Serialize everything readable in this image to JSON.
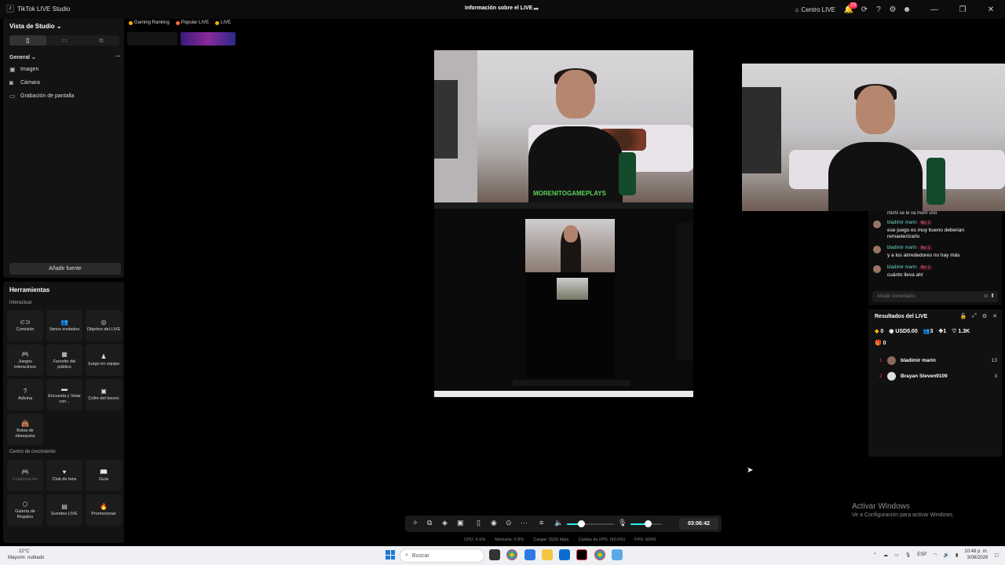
{
  "titlebar": {
    "app_title": "TikTok LIVE Studio",
    "center_title": "Información sobre el LIVE",
    "live_center": "Centro LIVE",
    "notif_count": "23"
  },
  "left_panel": {
    "studio_view": "Vista de Studio",
    "general": "General",
    "sources": [
      "Imagen",
      "Cámara",
      "Grabación de pantalla"
    ],
    "add_source": "Añadir fuente"
  },
  "tools": {
    "title": "Herramientas",
    "interact_label": "Interactuar",
    "growth_label": "Centro de crecimiento",
    "interact_items": [
      "Comisión",
      "Varios invitados",
      "Objetivo del LIVE",
      "Juegos interactivos",
      "Favorito del público",
      "Juego en equipo",
      "Adivina",
      "Encuesta y Votar con...",
      "Cofre del tesoro",
      "Bolsa de obsequios"
    ],
    "growth_items": [
      "Colaboración",
      "Club de fans",
      "Guía",
      "Galería de Regalos",
      "Eventos LIVE",
      "Promocionar"
    ]
  },
  "top_tabs": [
    "Gaming Ranking",
    "Popular LIVE",
    "LIVE"
  ],
  "preview": {
    "shirt_text": "MORENITOGAMEPLAYS"
  },
  "chat": {
    "top_text": "michi se le va morir uno",
    "messages": [
      {
        "user": "bladimir marin",
        "badge": "No. 1",
        "text": "ese juego es muy bueno deberian remasterizarlo"
      },
      {
        "user": "bladimir marin",
        "badge": "No. 1",
        "text": "y a los alrrededores no hay más"
      },
      {
        "user": "bladimir marin",
        "badge": "No. 1",
        "text": "cuánto lleva ahí"
      }
    ],
    "comment_placeholder": "Añadir comentario"
  },
  "results": {
    "title": "Resultados del LIVE",
    "coins": "0",
    "usd": "USD0.00",
    "viewers": "3",
    "new_followers": "1",
    "likes": "1.3K",
    "gifts": "0",
    "ranking": [
      {
        "rank": "1",
        "name": "bladimir marin",
        "count": "13"
      },
      {
        "rank": "2",
        "name": "Brayan Steven9109",
        "count": "3"
      }
    ]
  },
  "activate_windows": {
    "title": "Activar Windows",
    "sub": "Ve a Configuración para activar Windows."
  },
  "controls": {
    "timer": "03:06:42",
    "speaker_level": 0.3,
    "mic_level": 0.55
  },
  "stats": {
    "cpu": "CPU: 4.5%",
    "memory": "Memoria: 0.8%",
    "upload": "Cargar: 5526 kbps",
    "dropped": "Caídas de FPS: 0(0.0%)",
    "fps": "FPS: 60/60"
  },
  "taskbar": {
    "weather_temp": "22°C",
    "weather_desc": "Mayorm. nublado",
    "search": "Buscar",
    "lang": "ESP",
    "time": "10:48 p. m.",
    "date": "3/08/2026"
  },
  "colors": {
    "accent": "#25f4ee",
    "brand": "#fe2c55",
    "chat_user": "#6fd3c9"
  }
}
